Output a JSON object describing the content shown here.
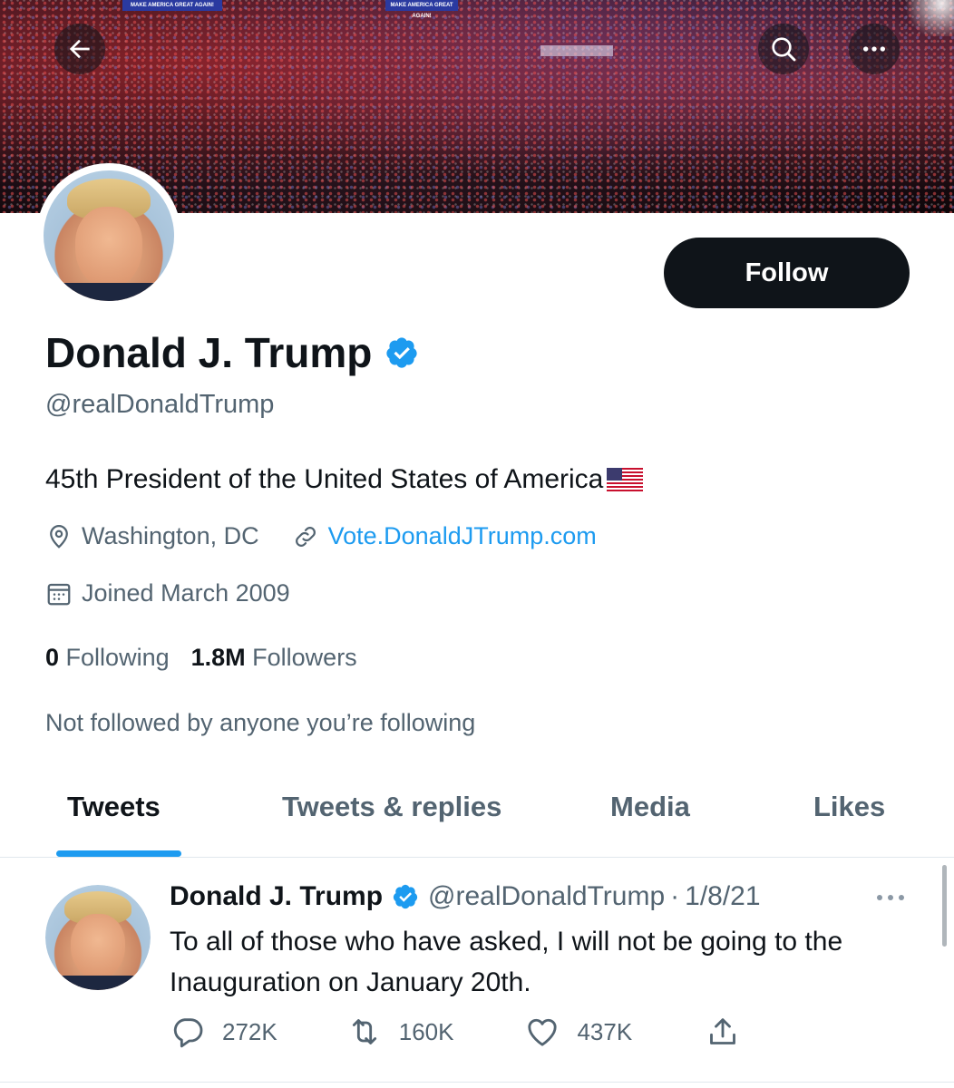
{
  "header": {
    "back_icon": "arrow-left-icon",
    "search_icon": "search-icon",
    "more_icon": "more-horizontal-icon",
    "banner_signs": [
      "MAKE AMERICA GREAT AGAIN!",
      "MAKE AMERICA GREAT AGAIN!"
    ]
  },
  "profile": {
    "display_name": "Donald J. Trump",
    "verified": true,
    "handle": "@realDonaldTrump",
    "bio": "45th President of the United States of America",
    "location": "Washington, DC",
    "website": "Vote.DonaldJTrump.com",
    "joined": "Joined March 2009",
    "following_count": "0",
    "following_label": "Following",
    "followers_count": "1.8M",
    "followers_label": "Followers",
    "not_followed": "Not followed by anyone you’re following",
    "follow_label": "Follow"
  },
  "tabs": [
    {
      "label": "Tweets",
      "active": true
    },
    {
      "label": "Tweets & replies",
      "active": false
    },
    {
      "label": "Media",
      "active": false
    },
    {
      "label": "Likes",
      "active": false
    }
  ],
  "tweet": {
    "name": "Donald J. Trump",
    "handle": "@realDonaldTrump",
    "separator": "·",
    "date": "1/8/21",
    "text": "To all of those who have asked, I will not be going to the Inauguration on January 20th.",
    "replies": "272K",
    "retweets": "160K",
    "likes": "437K"
  },
  "colors": {
    "accent": "#1d9bf0",
    "text_primary": "#0f1419",
    "text_secondary": "#536471",
    "follow_bg": "#0f1419"
  }
}
